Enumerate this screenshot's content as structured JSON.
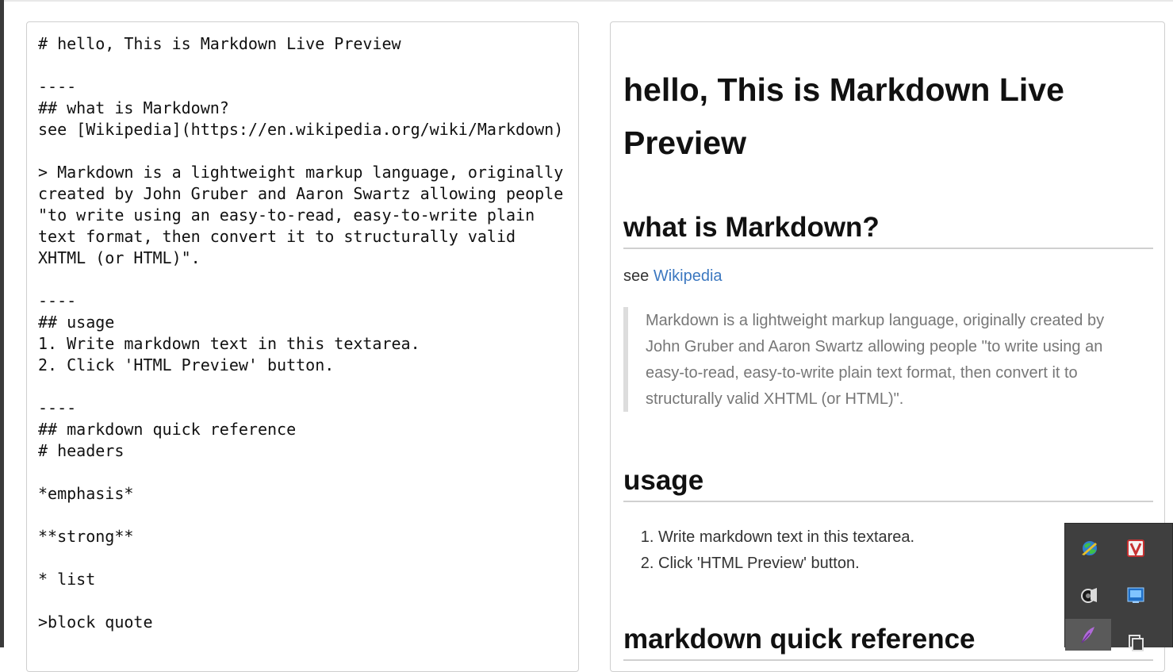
{
  "editor": {
    "text": "# hello, This is Markdown Live Preview\n\n----\n## what is Markdown?\nsee [Wikipedia](https://en.wikipedia.org/wiki/Markdown)\n\n> Markdown is a lightweight markup language, originally created by John Gruber and Aaron Swartz allowing people \"to write using an easy-to-read, easy-to-write plain text format, then convert it to structurally valid XHTML (or HTML)\".\n\n----\n## usage\n1. Write markdown text in this textarea.\n2. Click 'HTML Preview' button.\n\n----\n## markdown quick reference\n# headers\n\n*emphasis*\n\n**strong**\n\n* list\n\n>block quote"
  },
  "preview": {
    "h1": "hello, This is Markdown Live Preview",
    "h2_what": "what is Markdown?",
    "see_prefix": "see ",
    "link_text": "Wikipedia",
    "quote": "Markdown is a lightweight markup language, originally created by John Gruber and Aaron Swartz allowing people \"to write using an easy-to-read, easy-to-write plain text format, then convert it to structurally valid XHTML (or HTML)\".",
    "h2_usage": "usage",
    "usage_items": [
      "Write markdown text in this textarea.",
      "Click 'HTML Preview' button."
    ],
    "h2_reference": "markdown quick reference"
  },
  "tray": {
    "icons": [
      "network-globe-icon",
      "v-app-icon",
      "speaker-icon",
      "intel-graphics-icon",
      "feather-icon",
      "copy-clipboard-icon"
    ]
  },
  "colors": {
    "link": "#3c78c0",
    "quote_text": "#777777",
    "tray_bg": "#3f3f3f"
  }
}
